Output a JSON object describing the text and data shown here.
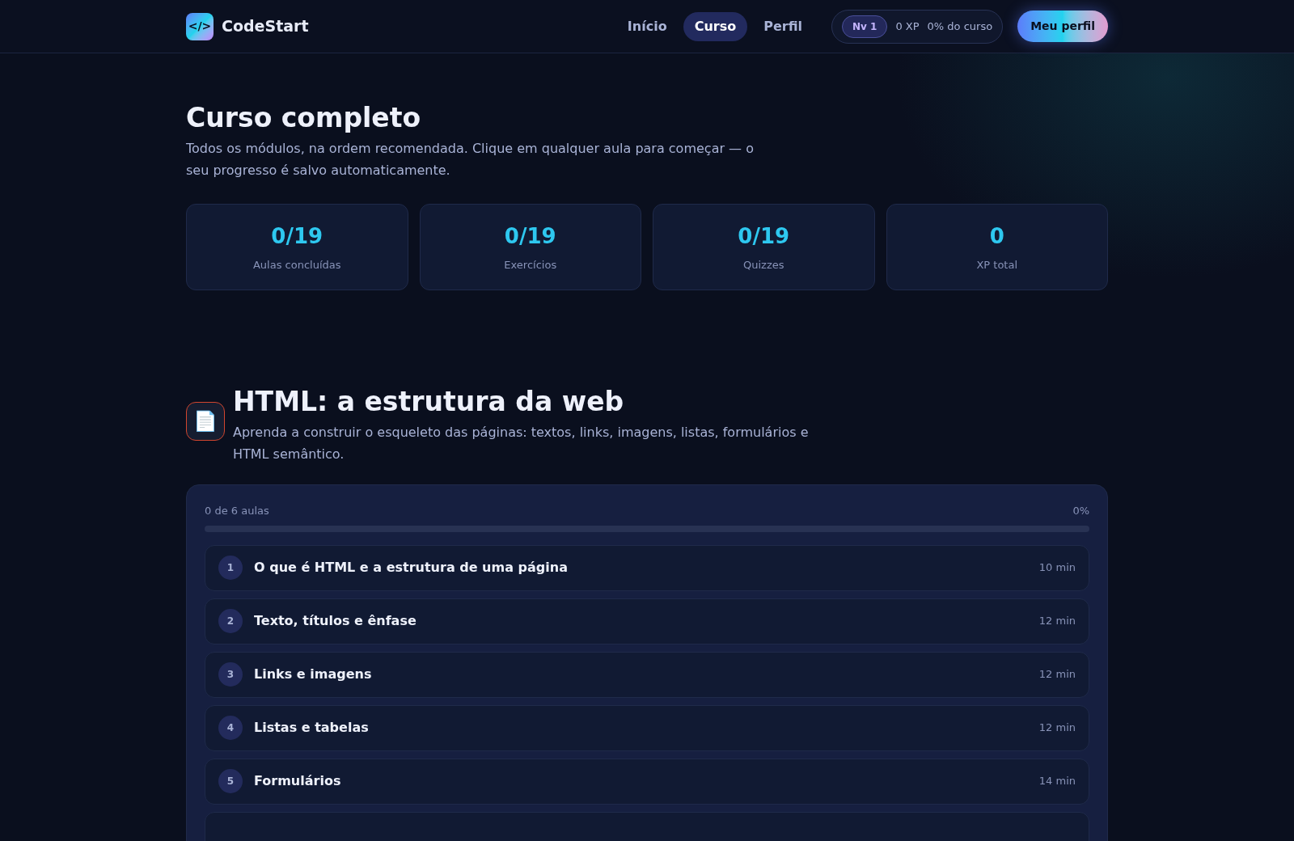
{
  "brand": {
    "name": "CodeStart",
    "logo": "</>"
  },
  "nav": [
    {
      "label": "Início",
      "selected": false
    },
    {
      "label": "Curso",
      "selected": true
    },
    {
      "label": "Perfil",
      "selected": false
    }
  ],
  "status": {
    "level_badge": "Nv 1",
    "xp": "0 XP",
    "course_progress": "0% do curso"
  },
  "profile_button": "Meu perfil",
  "page": {
    "title": "Curso completo",
    "subtitle": "Todos os módulos, na ordem recomendada. Clique em qualquer aula para começar — o seu progresso é salvo automaticamente."
  },
  "stats": [
    {
      "value": "0/19",
      "label": "Aulas concluídas"
    },
    {
      "value": "0/19",
      "label": "Exercícios"
    },
    {
      "value": "0/19",
      "label": "Quizzes"
    },
    {
      "value": "0",
      "label": "XP total"
    }
  ],
  "module": {
    "icon": "📄",
    "title": "HTML: a estrutura da web",
    "description": "Aprenda a construir o esqueleto das páginas: textos, links, imagens, listas, formulários e HTML semântico.",
    "progress_label": "0 de 6 aulas",
    "progress_percent": "0%",
    "level": 0,
    "lessons": [
      {
        "number": "1",
        "title": "O que é HTML e a estrutura de uma página",
        "duration": "10 min"
      },
      {
        "number": "2",
        "title": "Texto, títulos e ênfase",
        "duration": "12 min"
      },
      {
        "number": "3",
        "title": "Links e imagens",
        "duration": "12 min"
      },
      {
        "number": "4",
        "title": "Listas e tabelas",
        "duration": "12 min"
      },
      {
        "number": "5",
        "title": "Formulários",
        "duration": "14 min"
      }
    ]
  }
}
